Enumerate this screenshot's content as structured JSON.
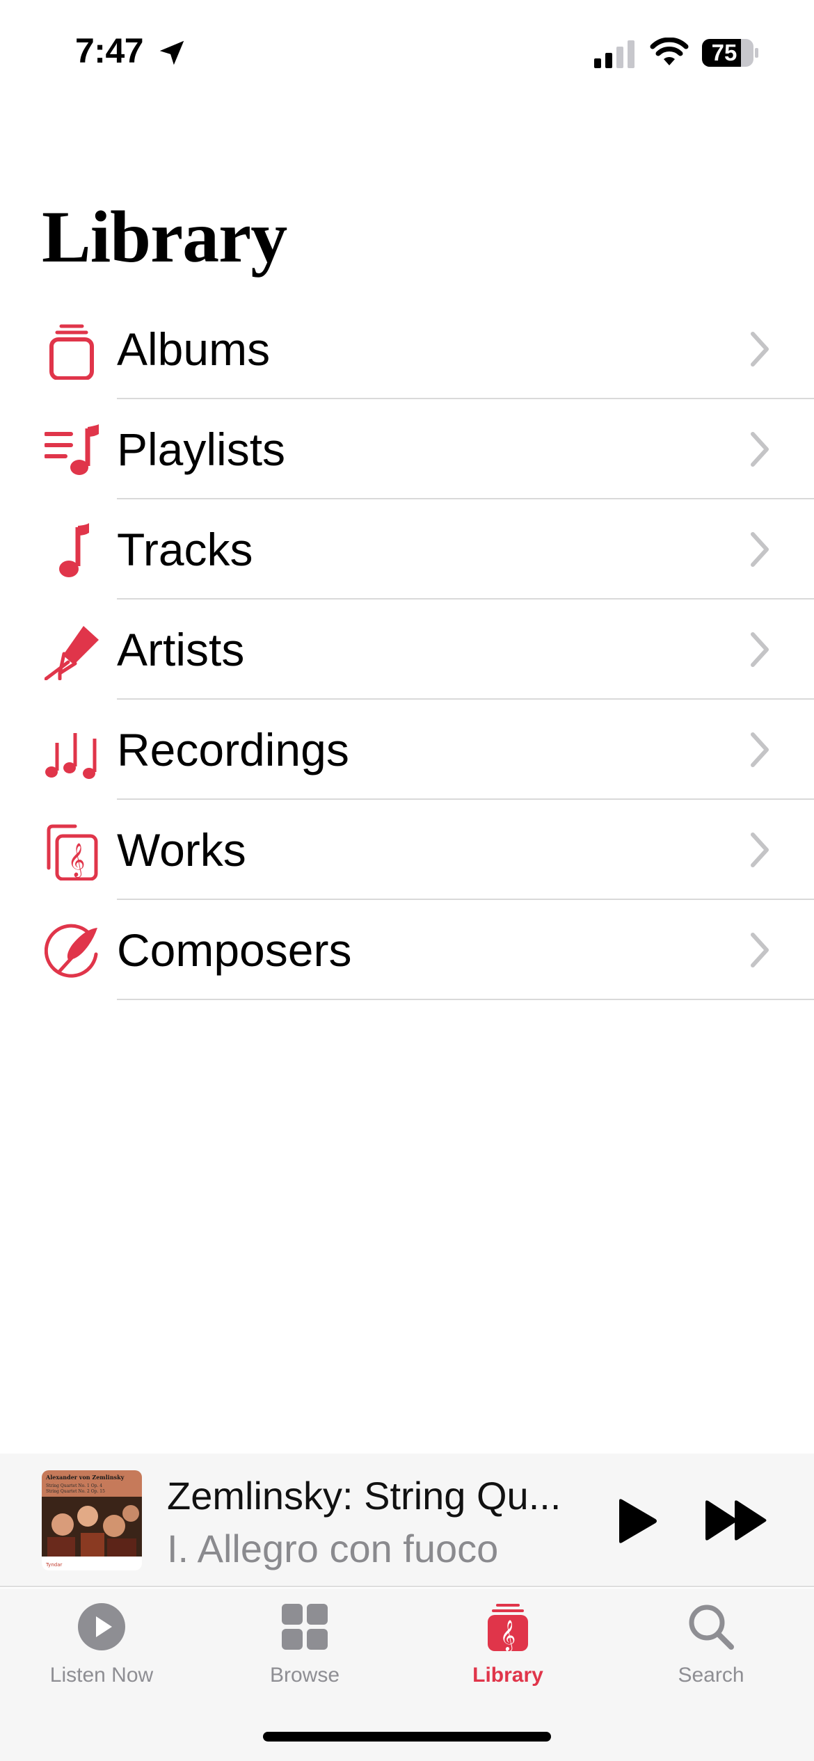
{
  "status_bar": {
    "time": "7:47",
    "battery_level": "75",
    "icons": [
      "location-arrow-icon",
      "cellular-signal-icon",
      "wifi-icon",
      "battery-icon"
    ]
  },
  "page": {
    "title": "Library"
  },
  "library_items": [
    {
      "label": "Albums",
      "icon": "albums-icon"
    },
    {
      "label": "Playlists",
      "icon": "playlists-icon"
    },
    {
      "label": "Tracks",
      "icon": "music-note-icon"
    },
    {
      "label": "Artists",
      "icon": "microphone-icon"
    },
    {
      "label": "Recordings",
      "icon": "notes-icon"
    },
    {
      "label": "Works",
      "icon": "score-icon"
    },
    {
      "label": "Composers",
      "icon": "quill-icon"
    }
  ],
  "mini_player": {
    "title": "Zemlinsky: String Qu...",
    "subtitle": "I. Allegro con fuoco",
    "album_art_text": {
      "composer": "Alexander von Zemlinsky",
      "line1": "String Quartet No. 1 Op. 4",
      "line2": "String Quartet No. 2 Op. 15",
      "label": "Tyndar"
    }
  },
  "tab_bar": {
    "tabs": [
      {
        "label": "Listen Now",
        "icon": "play-circle-icon",
        "active": false
      },
      {
        "label": "Browse",
        "icon": "grid-icon",
        "active": false
      },
      {
        "label": "Library",
        "icon": "library-icon",
        "active": true
      },
      {
        "label": "Search",
        "icon": "search-icon",
        "active": false
      }
    ]
  },
  "colors": {
    "accent": "#e0354a",
    "inactive": "#8e8e93",
    "divider": "#d9d9d9",
    "chevron": "#c4c4c6"
  }
}
